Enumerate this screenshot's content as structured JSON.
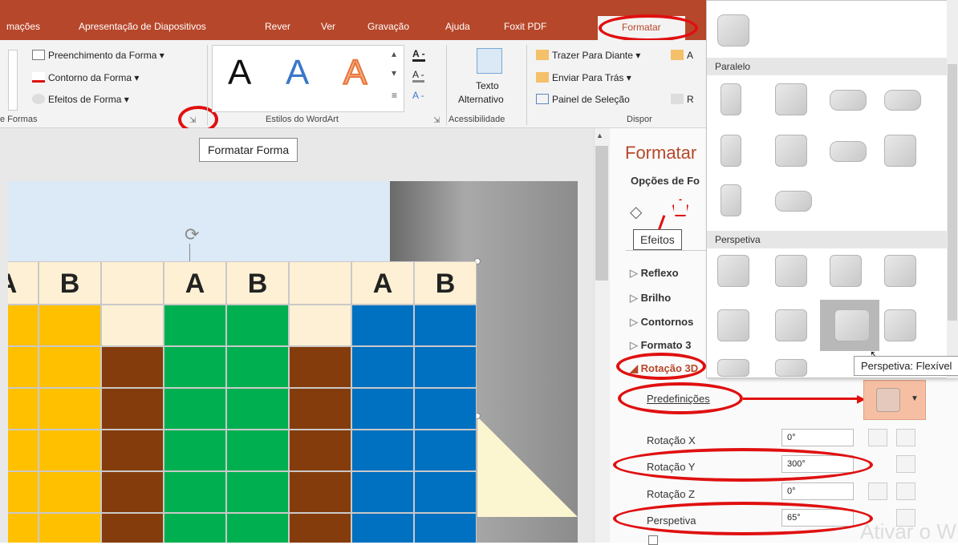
{
  "tabs": [
    "mações",
    "Apresentação de Diapositivos",
    "Rever",
    "Ver",
    "Gravação",
    "Ajuda",
    "Foxit PDF",
    "Formatar"
  ],
  "ribbon": {
    "shape_fill": "Preenchimento da Forma",
    "shape_outline": "Contorno da Forma",
    "shape_effects": "Efeitos de Forma",
    "group_shapes": "e Formas",
    "wordart_group": "Estilos do WordArt",
    "wordart_letter": "A",
    "alt_text_1": "Texto",
    "alt_text_2": "Alternativo",
    "accessibility": "Acessibilidade",
    "bring_forward": "Trazer Para Diante",
    "send_backward": "Enviar Para Trás",
    "selection_pane": "Painel de Seleção",
    "arrange": "Dispor",
    "a_small": "A",
    "r_small": "R"
  },
  "tooltip_format_shape": "Formatar Forma",
  "slide": {
    "headers": [
      "A",
      "B",
      "A",
      "B",
      "A",
      "B"
    ],
    "colors": {
      "yellow": "#ffc000",
      "green": "#00b050",
      "blue": "#0070c0",
      "brown": "#843c0c",
      "cream": "#fdf0d4"
    }
  },
  "pane": {
    "title": "Formatar",
    "subtitle": "Opções de Fo",
    "effects_tooltip": "Efeitos",
    "sections": [
      "Reflexo",
      "Brilho",
      "Contornos",
      "Formato 3",
      "Rotação 3D"
    ],
    "presets_label": "Predefinições",
    "rot_x_label": "Rotação X",
    "rot_x": "0°",
    "rot_y_label": "Rotação Y",
    "rot_y": "300°",
    "rot_z_label": "Rotação Z",
    "rot_z": "0°",
    "persp_label": "Perspetiva",
    "persp": "65°",
    "watermark": "Ativar o W"
  },
  "gallery": {
    "parallel": "Paralelo",
    "perspective": "Perspetiva",
    "tooltip": "Perspetiva: Flexível"
  }
}
